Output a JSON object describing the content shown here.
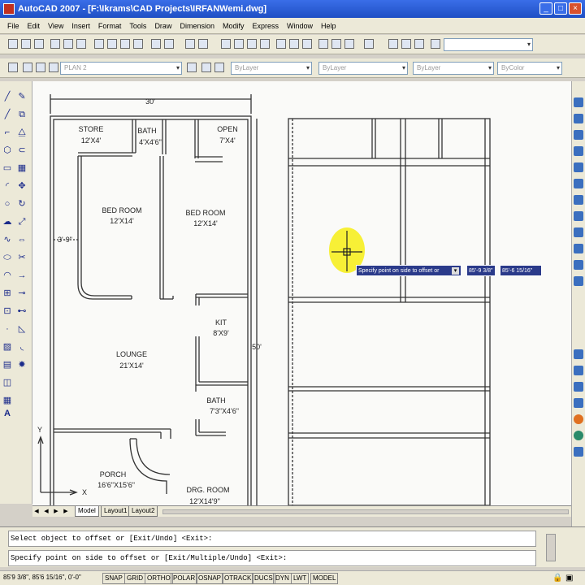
{
  "window": {
    "title": "AutoCAD 2007 - [F:\\Ikrams\\CAD Projects\\IRFANWemi.dwg]"
  },
  "menu": [
    "File",
    "Edit",
    "View",
    "Insert",
    "Format",
    "Tools",
    "Draw",
    "Dimension",
    "Modify",
    "Express",
    "Window",
    "Help"
  ],
  "toolbar": {
    "layer_combo": "PLAN 2",
    "bylayer_1": "ByLayer",
    "bylayer_2": "ByLayer",
    "bylayer_3": "ByLayer",
    "bycolor": "ByColor"
  },
  "drawing": {
    "dim_top": "30'",
    "dim_right": "50'",
    "dim_left": "3'-9\"",
    "rooms": [
      {
        "name": "STORE",
        "size": "12'X4'"
      },
      {
        "name": "BATH",
        "size": "4'X4'6\""
      },
      {
        "name": "OPEN",
        "size": "7'X4'"
      },
      {
        "name": "BED ROOM",
        "size": "12'X14'"
      },
      {
        "name": "BED ROOM",
        "size": "12'X14'"
      },
      {
        "name": "KIT",
        "size": "8'X9'"
      },
      {
        "name": "LOUNGE",
        "size": "21'X14'"
      },
      {
        "name": "BATH",
        "size": "7'3\"X4'6\""
      },
      {
        "name": "PORCH",
        "size": "16'6\"X15'6\""
      },
      {
        "name": "DRG. ROOM",
        "size": "12'X14'9\""
      }
    ],
    "ucs_x": "X",
    "ucs_y": "Y"
  },
  "tooltip": {
    "prompt": "Specify point on side to offset or",
    "value1": "85'-9 3/8\"",
    "value2": "85'-6 15/16\""
  },
  "tabs": [
    "Model",
    "Layout1",
    "Layout2"
  ],
  "command": {
    "line1": "Select object to offset or [Exit/Undo] <Exit>:",
    "line2": "Specify point on side to offset or [Exit/Multiple/Undo] <Exit>:"
  },
  "status": {
    "coords": "85'9 3/8\", 85'6 15/16\", 0'-0\"",
    "buttons": [
      "SNAP",
      "GRID",
      "ORTHO",
      "POLAR",
      "OSNAP",
      "OTRACK",
      "DUCS",
      "DYN",
      "LWT",
      "MODEL"
    ]
  }
}
